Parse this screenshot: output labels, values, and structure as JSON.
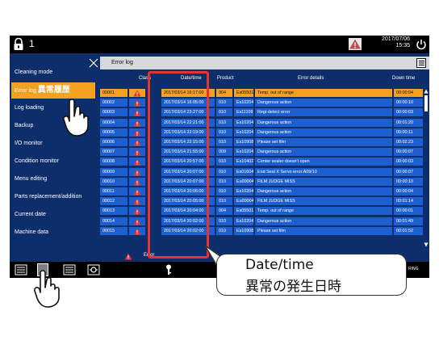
{
  "topbar": {
    "screen_number": "1",
    "date": "2017/07/06",
    "time": "15:35"
  },
  "sidebar": {
    "items": [
      {
        "label": "Cleaning mode"
      },
      {
        "label": "Error log",
        "label_jp": "異常履歴",
        "active": true
      },
      {
        "label": "Log loading"
      },
      {
        "label": "Backup"
      },
      {
        "label": "I/O monitor"
      },
      {
        "label": "Condition monitor"
      },
      {
        "label": "Menu editing"
      },
      {
        "label": "Parts replacement/addition"
      },
      {
        "label": "Current date"
      },
      {
        "label": "Machine data"
      }
    ]
  },
  "panel": {
    "title": "Error log"
  },
  "table": {
    "headers": [
      "Class",
      "Date/time",
      "Product",
      "Error details",
      "Down time"
    ],
    "rows": [
      {
        "no": "00001",
        "datetime": "2017/03/14 16:17:00",
        "product": "004",
        "code": "Es05501",
        "details": "Temp. out of range",
        "downtime": "00:00:04"
      },
      {
        "no": "00002",
        "datetime": "2017/03/14 16:05:00",
        "product": "010",
        "code": "Es10204",
        "details": "Dangerous action",
        "downtime": "00:00:10"
      },
      {
        "no": "00003",
        "datetime": "2017/03/14 23:27:00",
        "product": "010",
        "code": "Es11109",
        "details": "Regi-detect error",
        "downtime": "00:00:03"
      },
      {
        "no": "00004",
        "datetime": "2017/03/14 22:21:00",
        "product": "010",
        "code": "Es10204",
        "details": "Dangerous action",
        "downtime": "00:01:20"
      },
      {
        "no": "00005",
        "datetime": "2017/03/14 22:19:00",
        "product": "010",
        "code": "Es10204",
        "details": "Dangerous action",
        "downtime": "00:00:11"
      },
      {
        "no": "00006",
        "datetime": "2017/03/14 22:15:00",
        "product": "010",
        "code": "Es10908",
        "details": "Please set film",
        "downtime": "00:02:23"
      },
      {
        "no": "00007",
        "datetime": "2017/03/14 21:55:00",
        "product": "009",
        "code": "Es10204",
        "details": "Dangerous action",
        "downtime": "00:00:07"
      },
      {
        "no": "00008",
        "datetime": "2017/03/14 20:57:00",
        "product": "010",
        "code": "Es10402",
        "details": "Center sealer doesn't open",
        "downtime": "00:00:03"
      },
      {
        "no": "00009",
        "datetime": "2017/03/14 20:07:00",
        "product": "010",
        "code": "Es01604",
        "details": "End Seal X Servo error A09/10",
        "downtime": "00:00:07"
      },
      {
        "no": "00010",
        "datetime": "2017/03/14 20:07:00",
        "product": "010",
        "code": "Eu00004",
        "details": "FILM JUDGE MISS",
        "downtime": "00:00:10"
      },
      {
        "no": "00011",
        "datetime": "2017/03/14 20:06:00",
        "product": "010",
        "code": "Es10204",
        "details": "Dangerous action",
        "downtime": "00:00:04"
      },
      {
        "no": "00012",
        "datetime": "2017/03/14 20:05:00",
        "product": "010",
        "code": "Eu00004",
        "details": "FILM JUDGE MISS",
        "downtime": "00:01:14"
      },
      {
        "no": "00013",
        "datetime": "2017/03/14 20:04:00",
        "product": "004",
        "code": "Es05501",
        "details": "Temp. out of range",
        "downtime": "00:00:01"
      },
      {
        "no": "00014",
        "datetime": "2017/03/14 20:02:00",
        "product": "010",
        "code": "Es10204",
        "details": "Dangerous action",
        "downtime": "00:01:49"
      },
      {
        "no": "00015",
        "datetime": "2017/03/14 20:02:00",
        "product": "010",
        "code": "Es10908",
        "details": "Please set film",
        "downtime": "00:01:52"
      }
    ]
  },
  "status": {
    "text": "Error"
  },
  "footer": {
    "right_label": "RING"
  },
  "callout": {
    "line1": "Date/time",
    "line2": "異常の発生日時"
  },
  "colors": {
    "panel_bg": "#0d2d6b",
    "row_bg": "#1e5fd0",
    "selected_row": "#f4a020",
    "highlight_border": "#e53333"
  }
}
